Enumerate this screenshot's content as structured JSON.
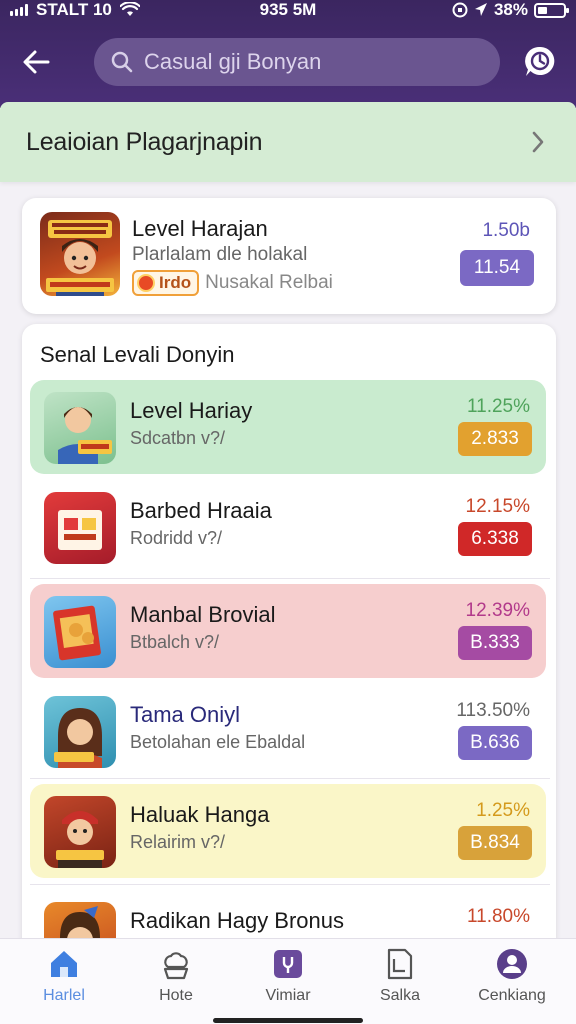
{
  "status": {
    "carrier": "STALT 10",
    "time": "935 5M",
    "battery": "38%",
    "battery_level": 0.38
  },
  "search": {
    "placeholder": "Casual gji Bonyan",
    "icon": "search-icon"
  },
  "promo": {
    "title": "Leaioian Plagarjnapin"
  },
  "featured": {
    "name": "Level Harajan",
    "subtitle": "Plarlalam dle holakal",
    "tag_label": "Irdo",
    "tag_text": "Nusakal Relbai",
    "stat": "1.50b",
    "badge": "11.54",
    "badge_color": "#7b69c4"
  },
  "list": {
    "title": "Senal Levali Donyin",
    "rows": [
      {
        "name": "Level Hariay",
        "subtitle": "Sdcatbn v?/",
        "stat": "11.25%",
        "badge": "2.833",
        "row_bg": "#c9ebcf",
        "stat_color": "#4fa35b",
        "badge_color": "#e2a12f"
      },
      {
        "name": "Barbed Hraaia",
        "subtitle": "Rodridd v?/",
        "stat": "12.15%",
        "badge": "6.338",
        "row_bg": "#ffffff",
        "stat_color": "#c8482b",
        "badge_color": "#d02828"
      },
      {
        "name": "Manbal Brovial",
        "subtitle": "Btbalch v?/",
        "stat": "12.39%",
        "badge": "B.333",
        "row_bg": "#f6cece",
        "stat_color": "#b23a8b",
        "badge_color": "#a54ba3"
      },
      {
        "name": "Tama Oniyl",
        "subtitle": "Betolahan ele Ebaldal",
        "stat": "113.50%",
        "badge": "B.636",
        "row_bg": "#ffffff",
        "stat_color": "#666666",
        "badge_color": "#7b69c4"
      },
      {
        "name": "Haluak Hanga",
        "subtitle": "Relairim v?/",
        "stat": "1.25%",
        "badge": "B.834",
        "row_bg": "#faf6c8",
        "stat_color": "#d49a1c",
        "badge_color": "#d8a23a"
      },
      {
        "name": "Radikan Hagy Bronus",
        "subtitle": "",
        "stat": "11.80%",
        "badge": "",
        "row_bg": "#ffffff",
        "stat_color": "#c8482b",
        "badge_color": "#cfe8f7"
      }
    ]
  },
  "nav": {
    "items": [
      {
        "label": "Harlel",
        "icon": "home-icon",
        "active": true
      },
      {
        "label": "Hote",
        "icon": "chef-hat-icon",
        "active": false
      },
      {
        "label": "Vimiar",
        "icon": "bag-icon",
        "active": false
      },
      {
        "label": "Salka",
        "icon": "document-icon",
        "active": false
      },
      {
        "label": "Cenkiang",
        "icon": "profile-icon",
        "active": false
      }
    ]
  }
}
